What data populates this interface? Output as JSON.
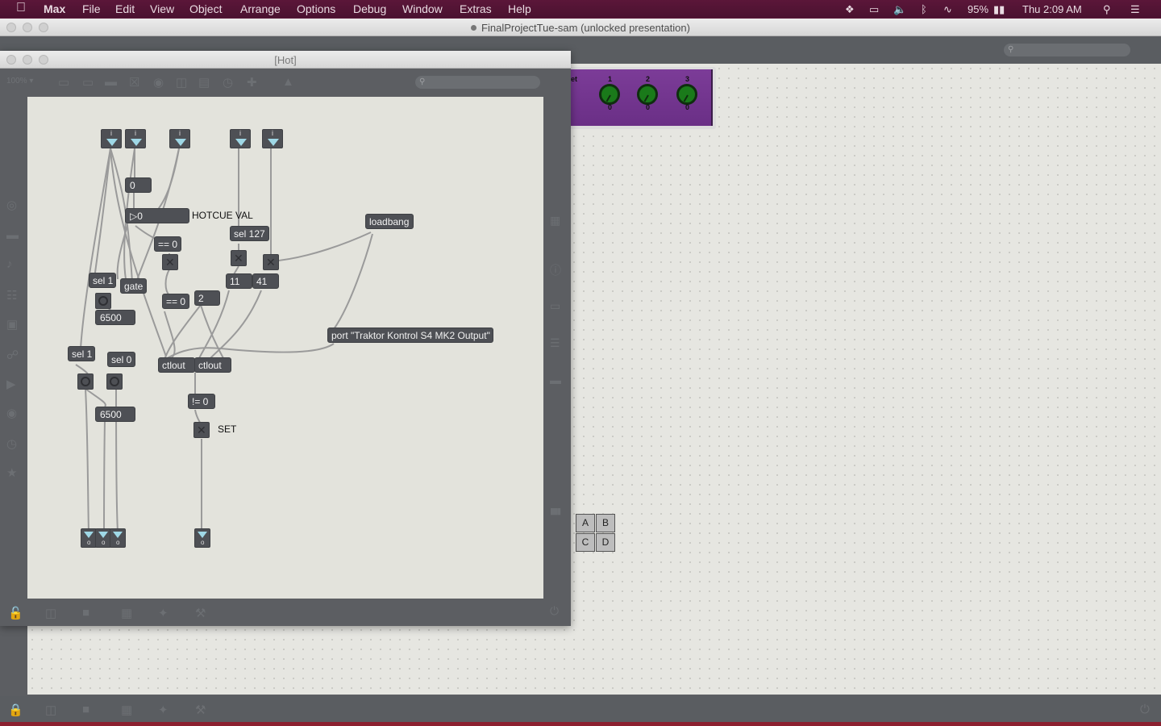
{
  "menubar": {
    "apple": "",
    "items": [
      "Max",
      "File",
      "Edit",
      "View",
      "Object",
      "Arrange",
      "Options",
      "Debug",
      "Window",
      "Extras",
      "Help"
    ],
    "battery": "95%",
    "clock": "Thu 2:09 AM"
  },
  "main_window": {
    "title": "FinalProjectTue-sam (unlocked presentation)"
  },
  "hot_window": {
    "title": "[Hot]",
    "zoom": "100% ▾"
  },
  "purple_panel": {
    "label_fragment": "et",
    "knobs": [
      {
        "label": "1",
        "value": "0"
      },
      {
        "label": "2",
        "value": "0"
      },
      {
        "label": "3",
        "value": "0"
      }
    ]
  },
  "abcd": [
    "A",
    "B",
    "C",
    "D"
  ],
  "patch": {
    "inlets": [
      "i",
      "i",
      "i",
      "i",
      "i"
    ],
    "number_zero": "0",
    "hotcue_number": "0",
    "hotcue_label": "HOTCUE VAL",
    "loadbang": "loadbang",
    "sel127": "sel 127",
    "eq0_a": "== 0",
    "eq0_b": "== 0",
    "msg11": "11",
    "msg41": "41",
    "msg2": "2",
    "sel1_a": "sel 1",
    "gate": "gate",
    "num6500_a": "6500",
    "sel1_b": "sel 1",
    "sel0": "sel 0",
    "num6500_b": "6500",
    "port_msg": "port \"Traktor Kontrol S4 MK2 Output\"",
    "ctlout_a": "ctlout",
    "ctlout_b": "ctlout",
    "neq0": "!= 0",
    "set_label": "SET",
    "outlet_o": "o"
  }
}
